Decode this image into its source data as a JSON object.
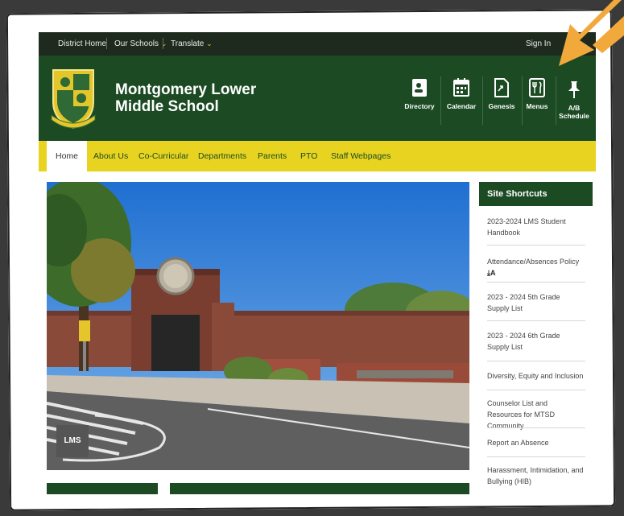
{
  "utility": {
    "district_home": "District Home",
    "our_schools": "Our Schools",
    "translate": "Translate",
    "sign_in": "Sign In"
  },
  "header": {
    "school_name": "Montgomery Lower Middle School",
    "quick_links": [
      {
        "label": "Directory",
        "icon": "directory-icon"
      },
      {
        "label": "Calendar",
        "icon": "calendar-icon"
      },
      {
        "label": "Genesis",
        "icon": "genesis-icon"
      },
      {
        "label": "Menus",
        "icon": "menus-icon"
      },
      {
        "label": "A/B Schedule",
        "icon": "pin-icon"
      }
    ]
  },
  "nav": {
    "tabs": [
      "Home",
      "About Us",
      "Co-Curricular",
      "Departments",
      "Parents",
      "PTO",
      "Staff Webpages"
    ]
  },
  "hero": {
    "caption": "LMS"
  },
  "shortcuts": {
    "title": "Site Shortcuts",
    "items": [
      "2023-2024 LMS Student Handbook",
      "Attendance/Absences Policy",
      "2023 - 2024 5th Grade Supply List",
      "2023 - 2024 6th Grade Supply List",
      "Diversity, Equity and Inclusion",
      "Counselor List and Resources for MTSD Community",
      "Report an Absence",
      "Harassment, Intimidation, and Bullying (HIB)"
    ]
  },
  "colors": {
    "brand_green": "#1b4a23",
    "brand_yellow": "#e8d420",
    "annotation_arrow": "#f2a93b"
  }
}
